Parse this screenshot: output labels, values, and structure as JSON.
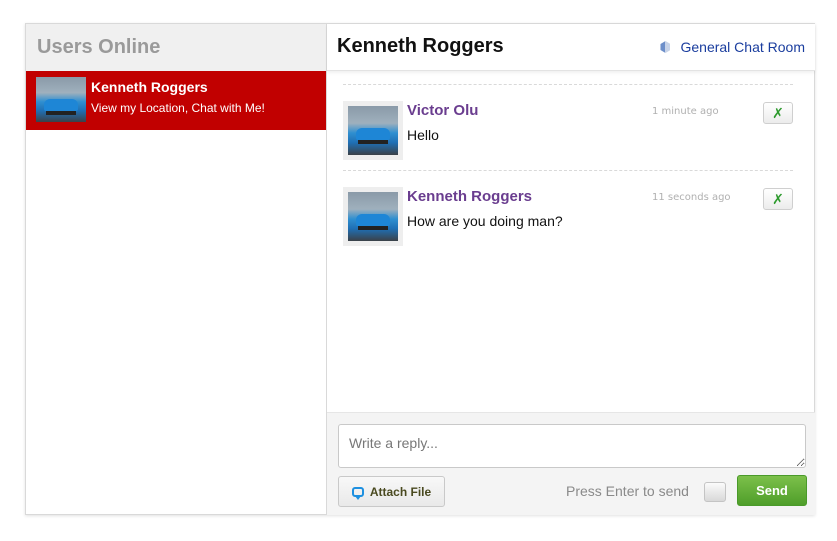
{
  "sidebar": {
    "title": "Users Online",
    "users": [
      {
        "name": "Kenneth Roggers",
        "status": "View my Location, Chat with Me!"
      }
    ]
  },
  "chat": {
    "title": "Kenneth Roggers",
    "room_link": "General Chat Room",
    "messages": [
      {
        "author": "Victor Olu",
        "text": "Hello",
        "time": "1 minute ago",
        "action_icon": "x-icon"
      },
      {
        "author": "Kenneth Roggers",
        "text": "How are you doing man?",
        "time": "11 seconds ago",
        "action_icon": "x-icon"
      }
    ]
  },
  "composer": {
    "placeholder": "Write a reply...",
    "attach_label": "Attach File",
    "enter_label": "Press Enter to send",
    "send_label": "Send"
  },
  "colors": {
    "selected_user_bg": "#c10000",
    "author_color": "#6a3d8f",
    "send_button": "#5aa832",
    "room_link": "#1a3d9e"
  }
}
